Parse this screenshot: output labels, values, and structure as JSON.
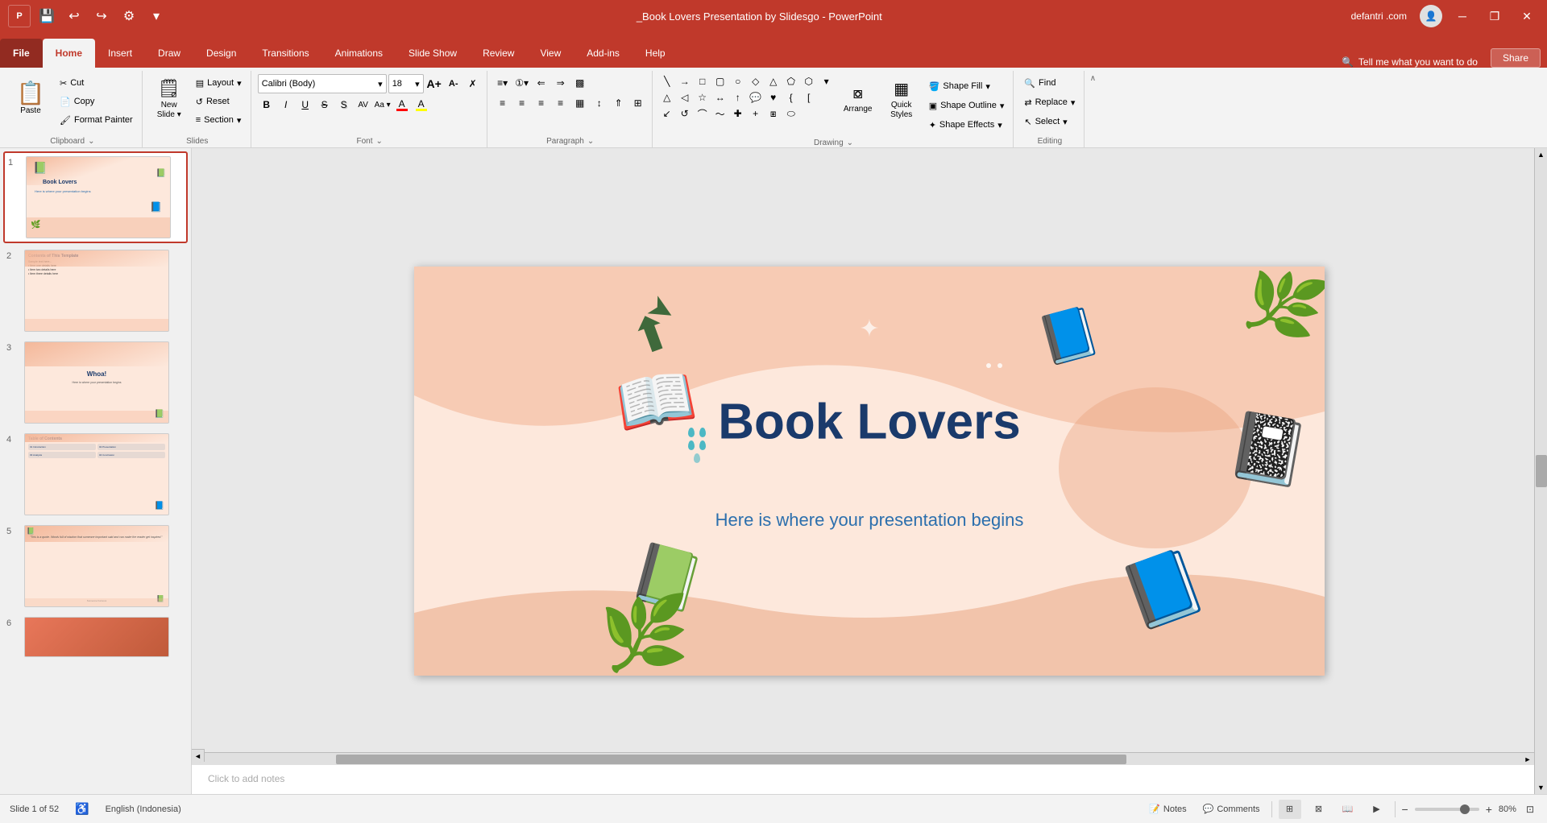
{
  "app": {
    "title": "_Book Lovers Presentation by Slidesgo - PowerPoint",
    "user": "defantri .com",
    "window_buttons": [
      "minimize",
      "restore",
      "close"
    ]
  },
  "titlebar": {
    "quick_access": [
      "save",
      "undo",
      "redo",
      "customize"
    ],
    "title": "_Book Lovers Presentation by Slidesgo - PowerPoint"
  },
  "tabs": [
    {
      "id": "file",
      "label": "File"
    },
    {
      "id": "home",
      "label": "Home",
      "active": true
    },
    {
      "id": "insert",
      "label": "Insert"
    },
    {
      "id": "draw",
      "label": "Draw"
    },
    {
      "id": "design",
      "label": "Design"
    },
    {
      "id": "transitions",
      "label": "Transitions"
    },
    {
      "id": "animations",
      "label": "Animations"
    },
    {
      "id": "slideshow",
      "label": "Slide Show"
    },
    {
      "id": "review",
      "label": "Review"
    },
    {
      "id": "view",
      "label": "View"
    },
    {
      "id": "addins",
      "label": "Add-ins"
    },
    {
      "id": "help",
      "label": "Help"
    }
  ],
  "search": {
    "placeholder": "Tell me what you want to do",
    "icon": "🔍"
  },
  "share_label": "Share",
  "ribbon": {
    "clipboard": {
      "label": "Clipboard",
      "paste_label": "Paste",
      "cut_label": "Cut",
      "copy_label": "Copy",
      "format_painter_label": "Format Painter",
      "clipboard_expand": "⌄"
    },
    "slides": {
      "label": "Slides",
      "new_slide_label": "New\nSlide",
      "layout_label": "Layout",
      "reset_label": "Reset",
      "section_label": "Section"
    },
    "font": {
      "label": "Font",
      "font_name": "Calibri (Body)",
      "font_size": "18",
      "grow_label": "A",
      "shrink_label": "A",
      "clear_label": "✗",
      "bold_label": "B",
      "italic_label": "I",
      "underline_label": "U",
      "strikethrough_label": "S",
      "shadow_label": "S",
      "spacing_label": "AV",
      "case_label": "Aa",
      "font_color_label": "A",
      "font_highlight_label": "A",
      "expand": "⌄"
    },
    "paragraph": {
      "label": "Paragraph",
      "expand": "⌄"
    },
    "drawing": {
      "label": "Drawing",
      "arrange_label": "Arrange",
      "quick_styles_label": "Quick\nStyles",
      "shape_fill_label": "Shape Fill",
      "shape_outline_label": "Shape Outline",
      "shape_effects_label": "Shape Effects",
      "expand": "⌄"
    },
    "editing": {
      "label": "Editing",
      "find_label": "Find",
      "replace_label": "Replace",
      "select_label": "Select"
    }
  },
  "slides": [
    {
      "number": "1",
      "active": true,
      "thumb_title": "Book Lovers",
      "thumb_subtitle": "Here is where your presentation begins",
      "bg": "#fde8dc"
    },
    {
      "number": "2",
      "active": false,
      "thumb_title": "Contents of This Template",
      "bg": "#fde8dc"
    },
    {
      "number": "3",
      "active": false,
      "thumb_title": "Whoa!",
      "bg": "#fde8dc"
    },
    {
      "number": "4",
      "active": false,
      "thumb_title": "Table of Contents",
      "bg": "#fde8dc"
    },
    {
      "number": "5",
      "active": false,
      "thumb_title": "",
      "bg": "#fde8dc"
    },
    {
      "number": "6",
      "active": false,
      "thumb_title": "",
      "bg": "#e8775a"
    }
  ],
  "main_slide": {
    "title": "Book Lovers",
    "subtitle": "Here is where your presentation begins",
    "slide_count": "52"
  },
  "bottom_bar": {
    "slide_info": "Slide 1 of 52",
    "language": "English (Indonesia)",
    "accessibility_icon": "♿",
    "notes_label": "Notes",
    "comments_label": "Comments",
    "zoom": "80%",
    "zoom_label": "80%"
  },
  "notes_placeholder": "Click to add notes"
}
